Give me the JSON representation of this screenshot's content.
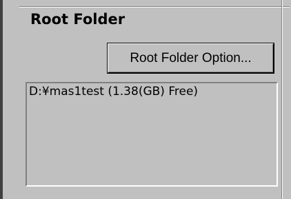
{
  "section": {
    "title": "Root Folder"
  },
  "buttons": {
    "root_folder_option_label": "Root Folder Option..."
  },
  "folder_list": {
    "items": [
      "D:¥mas1test (1.38(GB) Free)"
    ]
  }
}
